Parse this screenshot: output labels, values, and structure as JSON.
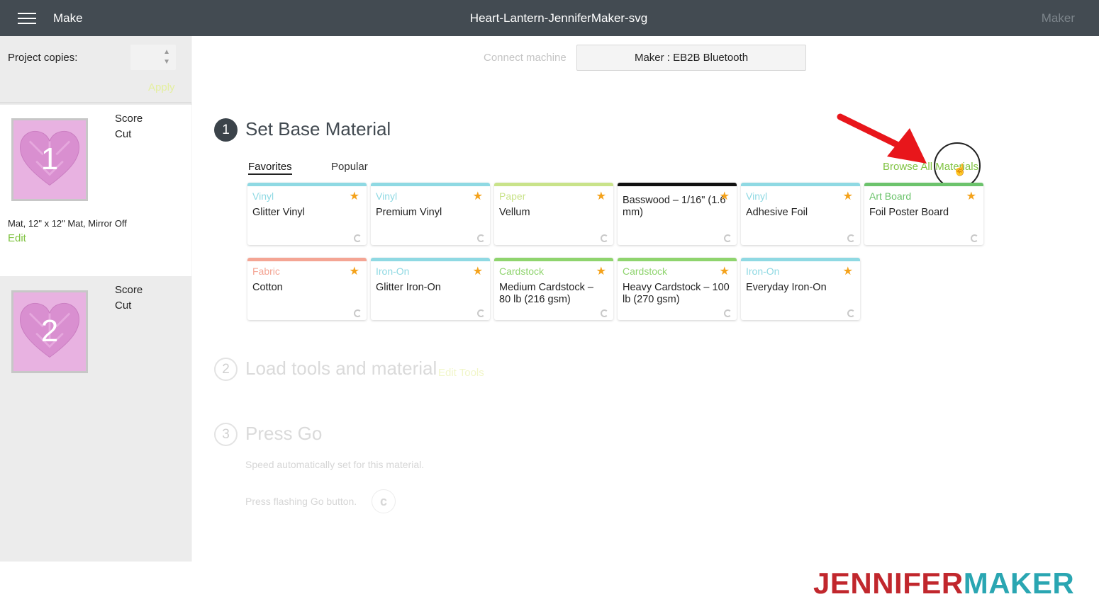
{
  "topbar": {
    "menu_icon": "hamburger-menu-icon",
    "make": "Make",
    "title": "Heart-Lantern-JenniferMaker-svg",
    "machine": "Maker"
  },
  "sidebar": {
    "copies_label": "Project copies:",
    "copies_value": "",
    "apply": "Apply",
    "mats": [
      {
        "number": "1",
        "ops": [
          "Score",
          "Cut"
        ],
        "info": "Mat, 12\" x 12\" Mat, Mirror Off",
        "edit": "Edit"
      },
      {
        "number": "2",
        "ops": [
          "Score",
          "Cut"
        ]
      }
    ]
  },
  "main": {
    "connect_label": "Connect machine",
    "machine_select": "Maker : EB2B Bluetooth",
    "step1": {
      "number": "1",
      "title": "Set Base Material"
    },
    "tabs": {
      "favorites": "Favorites",
      "popular": "Popular"
    },
    "browse_all": "Browse All Materials",
    "materials": [
      {
        "category": "Vinyl",
        "name": "Glitter Vinyl",
        "color": "#8fd9e3"
      },
      {
        "category": "Vinyl",
        "name": "Premium Vinyl",
        "color": "#8fd9e3"
      },
      {
        "category": "Paper",
        "name": "Vellum",
        "color": "#c9e38a"
      },
      {
        "category": "",
        "name": "Basswood – 1/16\" (1.6 mm)",
        "color": "#111111"
      },
      {
        "category": "Vinyl",
        "name": "Adhesive Foil",
        "color": "#8fd9e3"
      },
      {
        "category": "Art Board",
        "name": "Foil Poster Board",
        "color": "#6cc36c"
      },
      {
        "category": "Fabric",
        "name": "Cotton",
        "color": "#f4a594"
      },
      {
        "category": "Iron-On",
        "name": "Glitter Iron-On",
        "color": "#8fd9e3"
      },
      {
        "category": "Cardstock",
        "name": "Medium Cardstock – 80 lb (216 gsm)",
        "color": "#8fd46e"
      },
      {
        "category": "Cardstock",
        "name": "Heavy Cardstock – 100 lb (270 gsm)",
        "color": "#8fd46e"
      },
      {
        "category": "Iron-On",
        "name": "Everyday Iron-On",
        "color": "#8fd9e3"
      }
    ],
    "step2": {
      "number": "2",
      "title": "Load tools and material",
      "edit_tools": "Edit Tools"
    },
    "step3": {
      "number": "3",
      "title": "Press Go",
      "speed_text": "Speed automatically set for this material.",
      "press_text": "Press flashing Go button."
    }
  },
  "logo": {
    "part1": "JENNIFER",
    "part2": "MAKER"
  },
  "colors": {
    "topbar": "#434b52",
    "accent_green": "#80c342",
    "star": "#f4a21b",
    "arrow": "#e8161b",
    "logo_red": "#c1272d",
    "logo_teal": "#2aa6b2"
  }
}
